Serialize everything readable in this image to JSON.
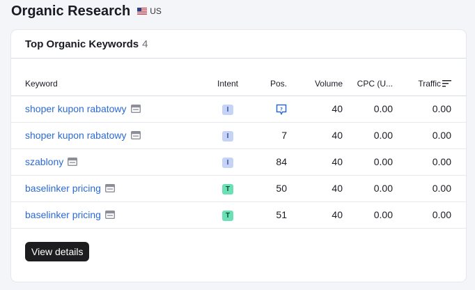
{
  "page": {
    "title": "Organic Research",
    "country_code": "US",
    "flag_icon": "us-flag-icon"
  },
  "card": {
    "title": "Top Organic Keywords",
    "count": "4"
  },
  "table": {
    "headers": {
      "keyword": "Keyword",
      "intent": "Intent",
      "pos": "Pos.",
      "volume": "Volume",
      "cpc": "CPC (U...",
      "traffic": "Traffic"
    },
    "rows": [
      {
        "keyword": "shoper kupon rabatowy",
        "intent": "I",
        "pos": "",
        "pos_icon": "serp-feature-icon",
        "volume": "40",
        "cpc": "0.00",
        "traffic": "0.00"
      },
      {
        "keyword": "shoper kupon rabatowy",
        "intent": "I",
        "pos": "7",
        "volume": "40",
        "cpc": "0.00",
        "traffic": "0.00"
      },
      {
        "keyword": "szablony",
        "intent": "I",
        "pos": "84",
        "volume": "40",
        "cpc": "0.00",
        "traffic": "0.00"
      },
      {
        "keyword": "baselinker pricing",
        "intent": "T",
        "pos": "50",
        "volume": "40",
        "cpc": "0.00",
        "traffic": "0.00"
      },
      {
        "keyword": "baselinker pricing",
        "intent": "T",
        "pos": "51",
        "volume": "40",
        "cpc": "0.00",
        "traffic": "0.00"
      }
    ]
  },
  "actions": {
    "view_details": "View details"
  },
  "colors": {
    "link": "#2b6ad6",
    "intent_i": "#c5d3f6",
    "intent_t": "#6be0b5",
    "button": "#1d1d1f"
  }
}
